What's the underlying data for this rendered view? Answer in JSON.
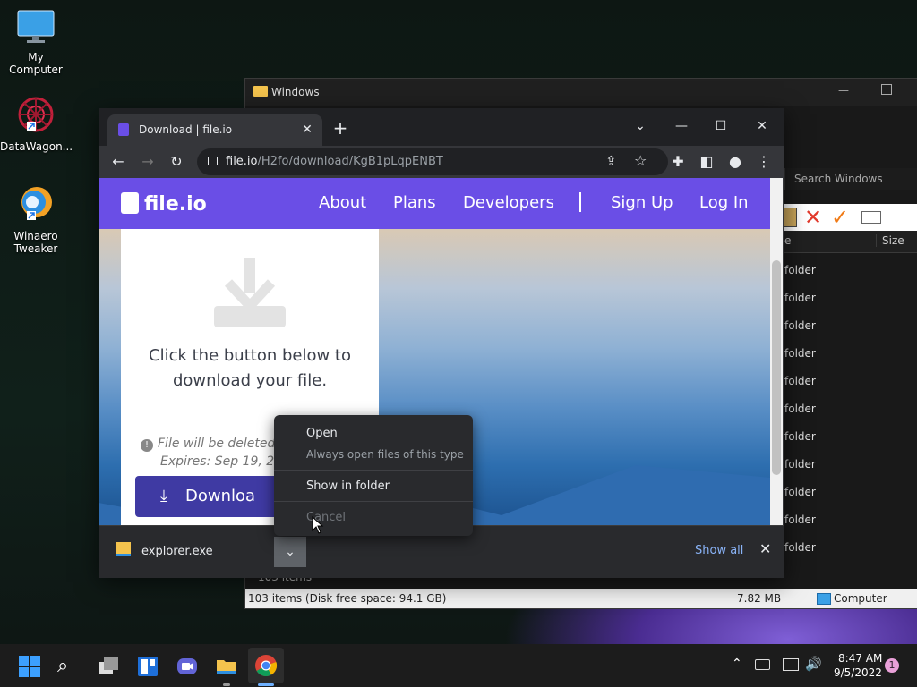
{
  "desktop": {
    "icons": [
      {
        "label": "My Computer"
      },
      {
        "label": "DataWagon..."
      },
      {
        "label": "Winaero Tweaker"
      }
    ]
  },
  "explorer": {
    "title": "Windows",
    "search_placeholder": "Search Windows",
    "columns": {
      "name": "e",
      "size": "Size"
    },
    "rows": [
      "folder",
      "folder",
      "folder",
      "folder",
      "folder",
      "folder",
      "folder",
      "folder",
      "folder",
      "folder",
      "folder"
    ],
    "items_count": "103 items",
    "status_left": "103 items (Disk free space: 94.1 GB)",
    "status_size": "7.82 MB",
    "status_location": "Computer"
  },
  "chrome": {
    "tab_title": "Download | file.io",
    "url_host": "file.io",
    "url_path": "/H2fo/download/KgB1pLqpENBT"
  },
  "site": {
    "logo": "file.io",
    "nav": [
      "About",
      "Plans",
      "Developers",
      "Sign Up",
      "Log In"
    ],
    "message_line1": "Click the button below to",
    "message_line2": "download your file.",
    "warn_line1": "File will be deleted a",
    "warn_line2": "Expires: Sep 19, 20",
    "download_label": "Downloa"
  },
  "shelf": {
    "filename": "explorer.exe",
    "show_all": "Show all"
  },
  "context_menu": {
    "open": "Open",
    "always_open": "Always open files of this type",
    "show_in_folder": "Show in folder",
    "cancel": "Cancel"
  },
  "taskbar": {
    "time": "8:47 AM",
    "date": "9/5/2022",
    "notifications": "1"
  }
}
